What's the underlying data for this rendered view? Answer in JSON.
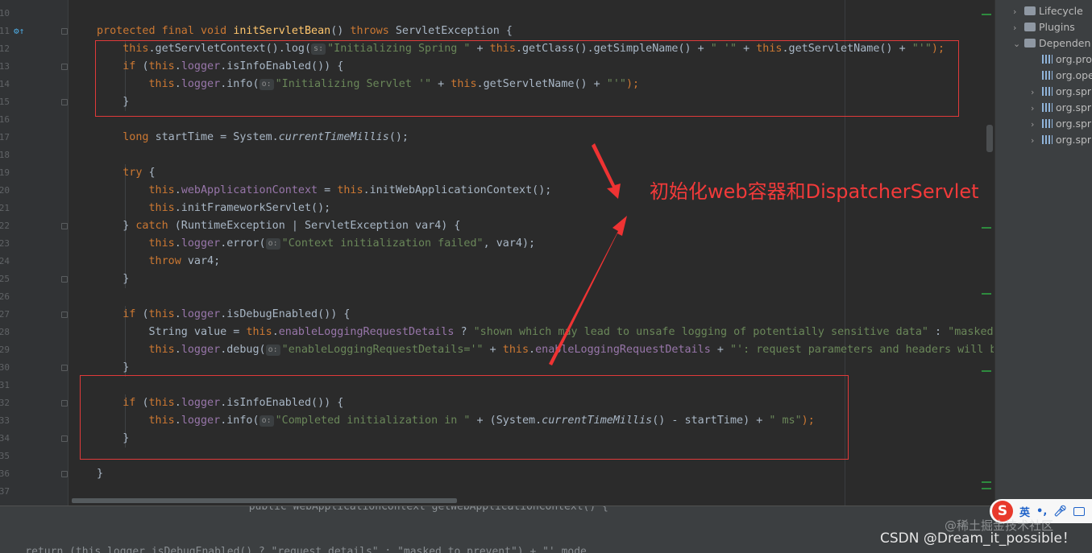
{
  "line_numbers": [
    "10",
    "11",
    "12",
    "13",
    "14",
    "15",
    "16",
    "17",
    "18",
    "19",
    "20",
    "21",
    "22",
    "23",
    "24",
    "25",
    "26",
    "27",
    "28",
    "29",
    "30",
    "31",
    "32",
    "33",
    "34",
    "35",
    "36",
    "37"
  ],
  "code": [
    {
      "tokens": []
    },
    {
      "tokens": [
        {
          "t": "protected final void ",
          "c": "k"
        },
        {
          "t": "initServletBean",
          "c": "m"
        },
        {
          "t": "() "
        },
        {
          "t": "throws ",
          "c": "k"
        },
        {
          "t": "ServletException {"
        }
      ]
    },
    {
      "tokens": [
        {
          "t": "    "
        },
        {
          "t": "this",
          "c": "k"
        },
        {
          "t": ".getServletContext().log("
        },
        {
          "t": "s:",
          "c": "hint"
        },
        {
          "t": "\"Initializing Spring \"",
          "c": "s"
        },
        {
          "t": " + "
        },
        {
          "t": "this",
          "c": "k"
        },
        {
          "t": ".getClass().getSimpleName() + "
        },
        {
          "t": "\" '\"",
          "c": "s"
        },
        {
          "t": " + "
        },
        {
          "t": "this",
          "c": "k"
        },
        {
          "t": ".getServletName() + "
        },
        {
          "t": "\"'\"",
          "c": "s"
        },
        {
          "t": ");",
          "c": "k"
        }
      ]
    },
    {
      "tokens": [
        {
          "t": "    "
        },
        {
          "t": "if ",
          "c": "k"
        },
        {
          "t": "("
        },
        {
          "t": "this",
          "c": "k"
        },
        {
          "t": "."
        },
        {
          "t": "logger",
          "c": "f"
        },
        {
          "t": ".isInfoEnabled()) {"
        }
      ]
    },
    {
      "tokens": [
        {
          "t": "        "
        },
        {
          "t": "this",
          "c": "k"
        },
        {
          "t": "."
        },
        {
          "t": "logger",
          "c": "f"
        },
        {
          "t": ".info("
        },
        {
          "t": "o:",
          "c": "hint"
        },
        {
          "t": "\"Initializing Servlet '\"",
          "c": "s"
        },
        {
          "t": " + "
        },
        {
          "t": "this",
          "c": "k"
        },
        {
          "t": ".getServletName() + "
        },
        {
          "t": "\"'\"",
          "c": "s"
        },
        {
          "t": ");",
          "c": "k"
        }
      ]
    },
    {
      "tokens": [
        {
          "t": "    }"
        }
      ]
    },
    {
      "tokens": []
    },
    {
      "tokens": [
        {
          "t": "    "
        },
        {
          "t": "long ",
          "c": "k"
        },
        {
          "t": "startTime = System."
        },
        {
          "t": "currentTimeMillis",
          "c": "i"
        },
        {
          "t": "();"
        }
      ]
    },
    {
      "tokens": []
    },
    {
      "tokens": [
        {
          "t": "    "
        },
        {
          "t": "try ",
          "c": "k"
        },
        {
          "t": "{"
        }
      ]
    },
    {
      "tokens": [
        {
          "t": "        "
        },
        {
          "t": "this",
          "c": "k"
        },
        {
          "t": "."
        },
        {
          "t": "webApplicationContext",
          "c": "f"
        },
        {
          "t": " = "
        },
        {
          "t": "this",
          "c": "k"
        },
        {
          "t": ".initWebApplicationContext();"
        }
      ]
    },
    {
      "tokens": [
        {
          "t": "        "
        },
        {
          "t": "this",
          "c": "k"
        },
        {
          "t": ".initFrameworkServlet();"
        }
      ]
    },
    {
      "tokens": [
        {
          "t": "    } "
        },
        {
          "t": "catch ",
          "c": "k"
        },
        {
          "t": "(RuntimeException | ServletException var4) {"
        }
      ]
    },
    {
      "tokens": [
        {
          "t": "        "
        },
        {
          "t": "this",
          "c": "k"
        },
        {
          "t": "."
        },
        {
          "t": "logger",
          "c": "f"
        },
        {
          "t": ".error("
        },
        {
          "t": "o:",
          "c": "hint"
        },
        {
          "t": "\"Context initialization failed\"",
          "c": "s"
        },
        {
          "t": ", var4);"
        }
      ]
    },
    {
      "tokens": [
        {
          "t": "        "
        },
        {
          "t": "throw ",
          "c": "k"
        },
        {
          "t": "var4;"
        }
      ]
    },
    {
      "tokens": [
        {
          "t": "    }"
        }
      ]
    },
    {
      "tokens": []
    },
    {
      "tokens": [
        {
          "t": "    "
        },
        {
          "t": "if ",
          "c": "k"
        },
        {
          "t": "("
        },
        {
          "t": "this",
          "c": "k"
        },
        {
          "t": "."
        },
        {
          "t": "logger",
          "c": "f"
        },
        {
          "t": ".isDebugEnabled()) {"
        }
      ]
    },
    {
      "tokens": [
        {
          "t": "        String value = "
        },
        {
          "t": "this",
          "c": "k"
        },
        {
          "t": "."
        },
        {
          "t": "enableLoggingRequestDetails",
          "c": "f"
        },
        {
          "t": " ? "
        },
        {
          "t": "\"shown which may lead to unsafe logging of potentially sensitive data\"",
          "c": "s"
        },
        {
          "t": " : "
        },
        {
          "t": "\"masked",
          "c": "s"
        }
      ]
    },
    {
      "tokens": [
        {
          "t": "        "
        },
        {
          "t": "this",
          "c": "k"
        },
        {
          "t": "."
        },
        {
          "t": "logger",
          "c": "f"
        },
        {
          "t": ".debug("
        },
        {
          "t": "o:",
          "c": "hint"
        },
        {
          "t": "\"enableLoggingRequestDetails='\"",
          "c": "s"
        },
        {
          "t": " + "
        },
        {
          "t": "this",
          "c": "k"
        },
        {
          "t": "."
        },
        {
          "t": "enableLoggingRequestDetails",
          "c": "f"
        },
        {
          "t": " + "
        },
        {
          "t": "\"': request parameters and headers will b",
          "c": "s"
        }
      ]
    },
    {
      "tokens": [
        {
          "t": "    }"
        }
      ]
    },
    {
      "tokens": []
    },
    {
      "tokens": [
        {
          "t": "    "
        },
        {
          "t": "if ",
          "c": "k"
        },
        {
          "t": "("
        },
        {
          "t": "this",
          "c": "k"
        },
        {
          "t": "."
        },
        {
          "t": "logger",
          "c": "f"
        },
        {
          "t": ".isInfoEnabled()) {"
        }
      ]
    },
    {
      "tokens": [
        {
          "t": "        "
        },
        {
          "t": "this",
          "c": "k"
        },
        {
          "t": "."
        },
        {
          "t": "logger",
          "c": "f"
        },
        {
          "t": ".info("
        },
        {
          "t": "o:",
          "c": "hint"
        },
        {
          "t": "\"Completed initialization in \"",
          "c": "s"
        },
        {
          "t": " + (System."
        },
        {
          "t": "currentTimeMillis",
          "c": "i"
        },
        {
          "t": "() - startTime) + "
        },
        {
          "t": "\" ms\"",
          "c": "s"
        },
        {
          "t": ");",
          "c": "k"
        }
      ]
    },
    {
      "tokens": [
        {
          "t": "    }"
        }
      ]
    },
    {
      "tokens": []
    },
    {
      "tokens": [
        {
          "t": "}"
        }
      ]
    },
    {
      "tokens": []
    }
  ],
  "annotation": "初始化web容器和DispatcherServlet",
  "tree": [
    {
      "label": "Lifecycle",
      "indent": 0,
      "chev": "›",
      "icon": "folder"
    },
    {
      "label": "Plugins",
      "indent": 0,
      "chev": "›",
      "icon": "folder"
    },
    {
      "label": "Dependen",
      "indent": 0,
      "chev": "⌄",
      "icon": "folder"
    },
    {
      "label": "org.pro",
      "indent": 1,
      "chev": "",
      "icon": "lib"
    },
    {
      "label": "org.ope",
      "indent": 1,
      "chev": "",
      "icon": "lib"
    },
    {
      "label": "org.spr",
      "indent": 1,
      "chev": "›",
      "icon": "lib"
    },
    {
      "label": "org.spr",
      "indent": 1,
      "chev": "›",
      "icon": "lib"
    },
    {
      "label": "org.spr",
      "indent": 1,
      "chev": "›",
      "icon": "lib"
    },
    {
      "label": "org.spr",
      "indent": 1,
      "chev": "›",
      "icon": "lib"
    }
  ],
  "ime": {
    "logo": "S",
    "lang": "英",
    "punct": "•,"
  },
  "watermark_cn": "@稀土掘金技术社区",
  "watermark": "CSDN @Dream_it_possible！",
  "bottom_code": "                   public WebApplicationContext getWebApplicationContext() {",
  "bottom_code2": "    return (this.logger.isDebugEnabled() ? \"request details\" : \"masked to prevent\") + \"' mode."
}
